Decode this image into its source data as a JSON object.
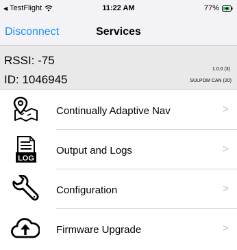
{
  "status_bar": {
    "back_app": "TestFlight",
    "time": "11:22 AM",
    "battery": "77%"
  },
  "nav": {
    "left_button": "Disconnect",
    "title": "Services"
  },
  "info": {
    "rssi": "RSSI: -75",
    "id": "ID: 1046945",
    "version": "1.0.0 (3)",
    "hardware": "SULPOM CAN (20)"
  },
  "menu": {
    "items": [
      {
        "label": "Continually Adaptive Nav",
        "icon": "map-pin-icon"
      },
      {
        "label": "Output and Logs",
        "icon": "log-document-icon"
      },
      {
        "label": "Configuration",
        "icon": "wrench-icon"
      },
      {
        "label": "Firmware Upgrade",
        "icon": "cloud-upload-icon"
      }
    ]
  },
  "colors": {
    "accent": "#1e90ff",
    "battery_charging": "#34c759",
    "chevron": "#c4c4c7"
  }
}
